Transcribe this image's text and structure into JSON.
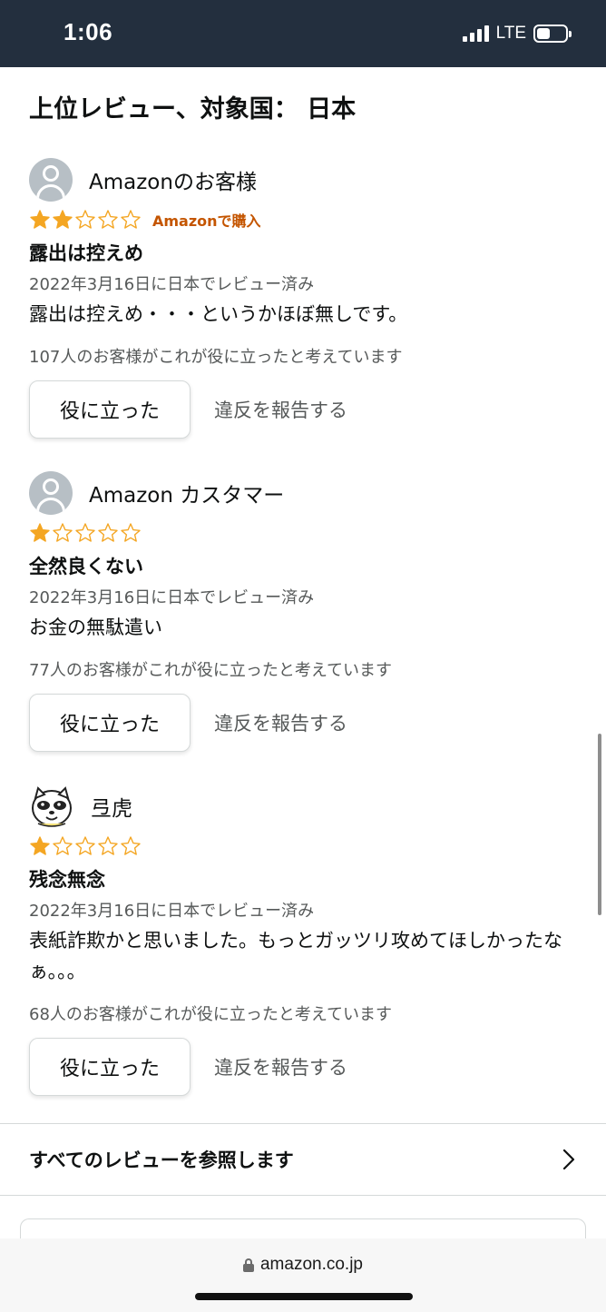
{
  "status": {
    "time": "1:06",
    "network": "LTE",
    "battery_level": 0.45
  },
  "section_title": "上位レビュー、対象国： 日本",
  "reviews": [
    {
      "reviewer": "Amazonのお客様",
      "avatar": "default-user-icon",
      "rating": 2,
      "badge": "Amazonで購入",
      "title": "露出は控えめ",
      "date": "2022年3月16日に日本でレビュー済み",
      "body": "露出は控えめ・・・というかほぼ無しです。",
      "helpful_count": "107人のお客様がこれが役に立ったと考えています",
      "helpful_label": "役に立った",
      "report_label": "違反を報告する"
    },
    {
      "reviewer": "Amazon カスタマー",
      "avatar": "default-user-icon",
      "rating": 1,
      "badge": "",
      "title": "全然良くない",
      "date": "2022年3月16日に日本でレビュー済み",
      "body": "お金の無駄遣い",
      "helpful_count": "77人のお客様がこれが役に立ったと考えています",
      "helpful_label": "役に立った",
      "report_label": "違反を報告する"
    },
    {
      "reviewer": "弖虎",
      "avatar": "dog-avatar-icon",
      "rating": 1,
      "badge": "",
      "title": "残念無念",
      "date": "2022年3月16日に日本でレビュー済み",
      "body": "表紙詐欺かと思いました。もっとガッツリ攻めてほしかったなぁ。。。",
      "helpful_count": "68人のお客様がこれが役に立ったと考えています",
      "helpful_label": "役に立った",
      "report_label": "違反を報告する"
    }
  ],
  "see_all_label": "すべてのレビューを参照します",
  "url": "amazon.co.jp",
  "colors": {
    "header": "#232f3e",
    "star": "#f4a623",
    "badge": "#c45500"
  }
}
